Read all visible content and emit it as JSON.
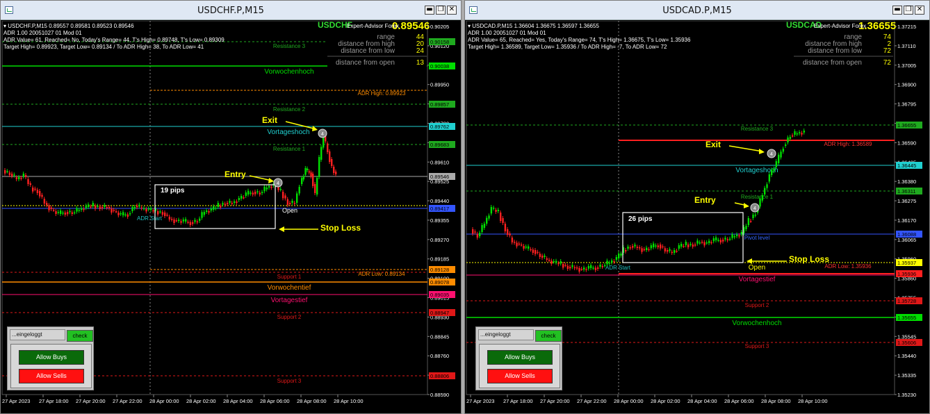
{
  "windows": [
    {
      "title": "USDCHF.P,M15",
      "win_buttons": [
        "▬",
        "❐",
        "✕"
      ],
      "symbol_line": "USDCHF.P,M15  0.89557 0.89581 0.89523 0.89546",
      "adr_line": "ADR 1.00 20051027 01 Mod 01",
      "adr_value_line": "ADR Value= 61, Reached= No, Today's Range= 44, T's High= 0.89748, T's Low= 0.89309",
      "target_line": "Target High= 0.89923, Target Low= 0.89134 / To ADR High= 38, To ADR Low= 41",
      "ea_label": "Expert-Advisor Forex",
      "big_symbol": "USDCHF",
      "big_price": "0.89546",
      "stats": [
        {
          "label": "range",
          "value": "44"
        },
        {
          "label": "distance from high",
          "value": "20"
        },
        {
          "label": "distance from low",
          "value": "24"
        },
        {
          "label": "distance from open",
          "value": "13"
        }
      ],
      "levels": [
        "Resistance 3",
        "Vorwochenhoch",
        "ADR High: 0.89923",
        "Resistance 2",
        "Vortageshoch",
        "Resistance 1",
        "Open",
        "ADR Start",
        "Support 1",
        "ADR Low: 0.89134",
        "Vorwochentief",
        "Vortagestief",
        "Support 2",
        "Support 3"
      ],
      "annotations": {
        "exit": "Exit",
        "entry": "Entry",
        "pips": "19 pips",
        "stop_loss": "Stop Loss",
        "exit_marker": "4",
        "entry_marker": "4"
      },
      "y_ticks": [
        "0.90205",
        "0.90120",
        "0.90035",
        "0.89950",
        "0.89865",
        "0.89780",
        "0.89695",
        "0.89610",
        "0.89525",
        "0.89440",
        "0.89355",
        "0.89270",
        "0.89185",
        "0.89100",
        "0.89015",
        "0.88930",
        "0.88845",
        "0.88760",
        "0.88675",
        "0.88590"
      ],
      "price_tags": [
        "0.90158",
        "0.90038",
        "0.89857",
        "0.89762",
        "0.89683",
        "0.89546",
        "0.89417",
        "0.89128",
        "0.89078",
        "0.89035",
        "0.88947",
        "0.88806"
      ],
      "x_ticks": [
        "27 Apr 2023",
        "27 Apr 18:00",
        "27 Apr 20:00",
        "27 Apr 22:00",
        "28 Apr 00:00",
        "28 Apr 02:00",
        "28 Apr 04:00",
        "28 Apr 06:00",
        "28 Apr 08:00",
        "28 Apr 10:00"
      ],
      "panel": {
        "login": "...eingeloggt",
        "check": "check",
        "buys": "Allow Buys",
        "sells": "Allow Sells"
      }
    },
    {
      "title": "USDCAD.P,M15",
      "win_buttons": [
        "▬",
        "❐",
        "✕"
      ],
      "symbol_line": "USDCAD.P,M15  1.36604 1.36675 1.36597 1.36655",
      "adr_line": "ADR 1.00 20051027 01 Mod 01",
      "adr_value_line": "ADR Value= 65, Reached= Yes, Today's Range= 74, T's High= 1.36675, T's Low= 1.35936",
      "target_line": "Target High= 1.36589, Target Low= 1.35936 / To ADR High= -7, To ADR Low= 72",
      "ea_label": "Expert-Advisor Forex",
      "big_symbol": "USDCAD",
      "big_price": "1.36655",
      "stats": [
        {
          "label": "range",
          "value": "74"
        },
        {
          "label": "distance from high",
          "value": "2"
        },
        {
          "label": "distance from low",
          "value": "72"
        },
        {
          "label": "distance from open",
          "value": "72"
        }
      ],
      "levels": [
        "Resistance 3",
        "ADR High: 1.36589",
        "Vortageshoch",
        "Resistance 1",
        "Pivot level",
        "ADR Start",
        "Open",
        "ADR Low: 1.35936",
        "Vortagestief",
        "Support 2",
        "Vorwochenhoch",
        "Support 3"
      ],
      "annotations": {
        "exit": "Exit",
        "entry": "Entry",
        "pips": "26 pips",
        "stop_loss": "Stop Loss",
        "exit_marker": "4",
        "entry_marker": "4"
      },
      "y_ticks": [
        "1.37215",
        "1.37110",
        "1.37005",
        "1.36900",
        "1.36795",
        "1.36690",
        "1.36590",
        "1.36485",
        "1.36380",
        "1.36275",
        "1.36170",
        "1.36065",
        "1.35960",
        "1.35860",
        "1.35755",
        "1.35650",
        "1.35545",
        "1.35440",
        "1.35335",
        "1.35230"
      ],
      "price_tags": [
        "1.36655",
        "1.36445",
        "1.36311",
        "1.36088",
        "1.35937",
        "1.35936",
        "1.35728",
        "1.35655",
        "1.35606"
      ],
      "x_ticks": [
        "27 Apr 2023",
        "27 Apr 18:00",
        "27 Apr 20:00",
        "27 Apr 22:00",
        "28 Apr 00:00",
        "28 Apr 02:00",
        "28 Apr 04:00",
        "28 Apr 06:00",
        "28 Apr 08:00",
        "28 Apr 10:00"
      ],
      "panel": {
        "login": "...eingeloggt",
        "check": "check",
        "buys": "Allow Buys",
        "sells": "Allow Sells"
      }
    }
  ],
  "colors": {
    "bull": "#00e000",
    "bear": "#ff2020",
    "resistance": "#1faa1f",
    "support": "#e01818",
    "vortag": "#20d0d0",
    "vortagestief": "#ff1070",
    "adr": "#ff8c00",
    "open": "#ffff00",
    "annotation": "#ffff00"
  }
}
